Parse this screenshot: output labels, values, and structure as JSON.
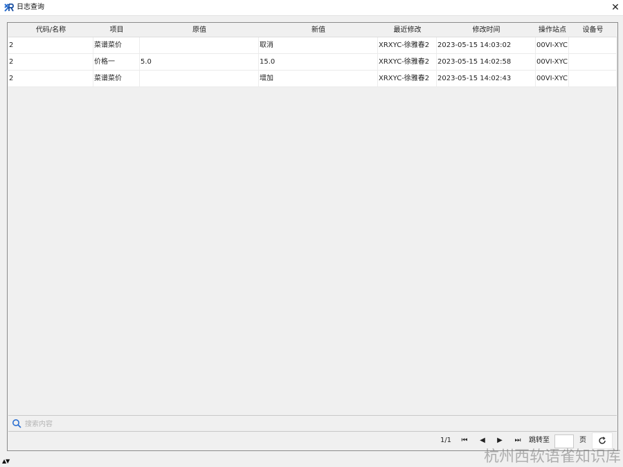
{
  "window": {
    "title": "日志查询",
    "close_glyph": "✕"
  },
  "table": {
    "columns": [
      "代码/名称",
      "项目",
      "原值",
      "新值",
      "最近修改",
      "修改时间",
      "操作站点",
      "设备号"
    ],
    "rows": [
      [
        "2",
        "菜谱菜价",
        "",
        "取消",
        "XRXYC-徐雅春2",
        "2023-05-15 14:03:02",
        "00VI-XYC",
        ""
      ],
      [
        "2",
        "价格一",
        "5.0",
        "15.0",
        "XRXYC-徐雅春2",
        "2023-05-15 14:02:58",
        "00VI-XYC",
        ""
      ],
      [
        "2",
        "菜谱菜价",
        "",
        "增加",
        "XRXYC-徐雅春2",
        "2023-05-15 14:02:43",
        "00VI-XYC",
        ""
      ]
    ]
  },
  "search": {
    "placeholder": "搜索内容",
    "value": ""
  },
  "pager": {
    "page_info": "1/1",
    "first_glyph": "⏮",
    "prev_glyph": "◀",
    "next_glyph": "▶",
    "last_glyph": "⏭",
    "jump_label": "跳转至",
    "page_input_value": "",
    "page_unit": "页"
  },
  "footer": {
    "arrows": "▲▼",
    "watermark": "杭州西软语雀知识库"
  },
  "colors": {
    "accent": "#2a6fd1",
    "background": "#f0f0f0",
    "row_background": "#ffffff"
  },
  "icons": {
    "app_logo": "xr-logo-icon",
    "close": "close-icon",
    "search": "search-icon",
    "refresh": "refresh-icon"
  }
}
